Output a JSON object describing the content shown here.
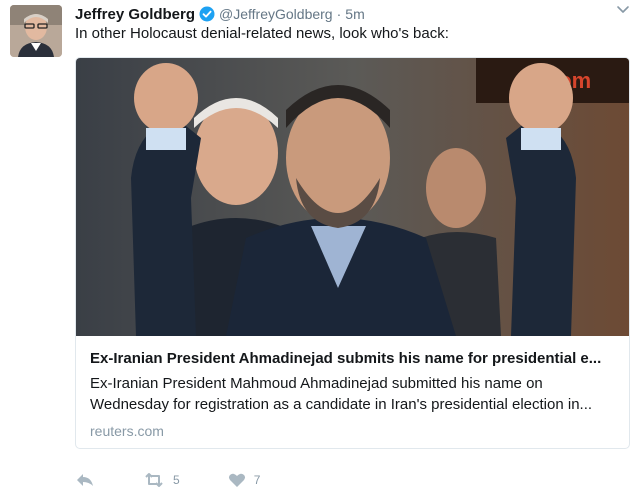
{
  "tweet": {
    "author_name": "Jeffrey Goldberg",
    "handle": "@JeffreyGoldberg",
    "separator": "·",
    "time": "5m",
    "text": "In other Holocaust denial-related news, look who's back:",
    "verified": true,
    "avatar_icon": "user-avatar"
  },
  "card": {
    "title": "Ex-Iranian President Ahmadinejad submits his name for presidential e...",
    "description_line1": "Ex-Iranian President Mahmoud Ahmadinejad submitted his name on",
    "description_line2": "Wednesday for registration as a candidate in Iran's presidential election in...",
    "domain": "reuters.com",
    "image_icon": "news-photo"
  },
  "actions": {
    "reply_icon": "reply-icon",
    "retweet_count": "5",
    "like_count": "7"
  },
  "colors": {
    "text": "#14171a",
    "muted": "#657786",
    "light_muted": "#8899a6",
    "verified": "#1da1f2",
    "border": "#e1e8ed",
    "icon": "#aab8c2"
  }
}
